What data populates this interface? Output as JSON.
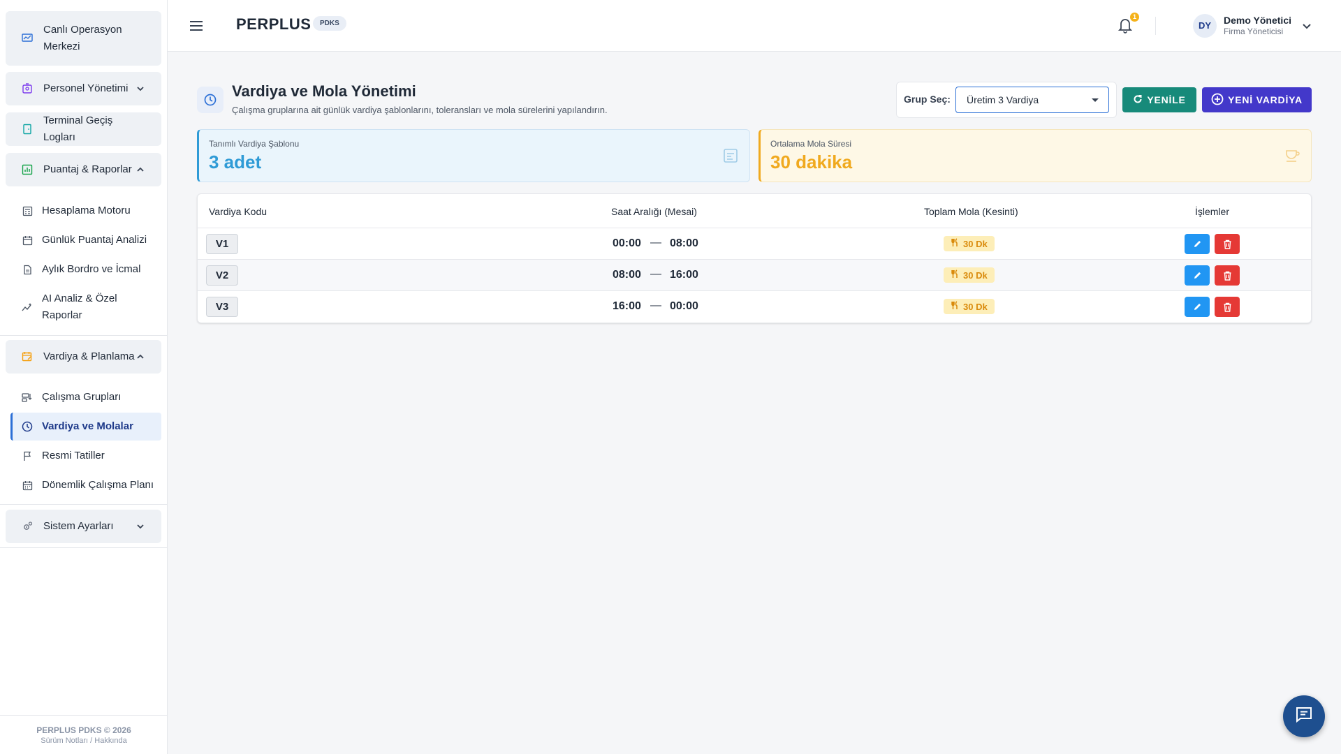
{
  "sidebar": {
    "groups": {
      "live": {
        "label": "Canlı Operasyon\nMerkezi"
      },
      "personnel": {
        "label": "Personel Yönetimi"
      },
      "terminal": {
        "label": "Terminal Geçiş Logları"
      },
      "puantaj": {
        "label": "Puantaj & Raporlar"
      },
      "vardiya": {
        "label": "Vardiya & Planlama"
      },
      "system": {
        "label": "Sistem Ayarları"
      }
    },
    "puantaj_items": [
      {
        "label": "Hesaplama Motoru"
      },
      {
        "label": "Günlük Puantaj Analizi"
      },
      {
        "label": "Aylık Bordro ve İcmal"
      },
      {
        "label": "AI Analiz & Özel\nRaporlar"
      }
    ],
    "vardiya_items": [
      {
        "label": "Çalışma Grupları"
      },
      {
        "label": "Vardiya ve Molalar"
      },
      {
        "label": "Resmi Tatiller"
      },
      {
        "label": "Dönemlik Çalışma Planı"
      }
    ],
    "footer": {
      "line1": "PERPLUS PDKS © 2026",
      "line2": "Sürüm Notları / Hakkında"
    }
  },
  "topbar": {
    "brand": "PERPLUS",
    "brand_badge": "PDKS",
    "notification_count": "1",
    "user": {
      "initials": "DY",
      "name": "Demo Yönetici",
      "role": "Firma Yöneticisi"
    }
  },
  "page": {
    "title": "Vardiya ve Mola Yönetimi",
    "subtitle": "Çalışma gruplarına ait günlük vardiya şablonlarını, toleransları ve mola sürelerini yapılandırın.",
    "group_label": "Grup Seç:",
    "group_value": "Üretim 3 Vardiya",
    "refresh_label": "YENİLE",
    "new_label": "YENİ VARDİYA"
  },
  "stats": {
    "templates": {
      "caption": "Tanımlı Vardiya Şablonu",
      "value": "3 adet"
    },
    "break": {
      "caption": "Ortalama Mola Süresi",
      "value": "30 dakika"
    }
  },
  "table": {
    "headers": {
      "code": "Vardiya Kodu",
      "range": "Saat Aralığı (Mesai)",
      "break": "Toplam Mola (Kesinti)",
      "actions": "İşlemler"
    },
    "rows": [
      {
        "code": "V1",
        "start": "00:00",
        "dash": "—",
        "end": "08:00",
        "break": "30 Dk"
      },
      {
        "code": "V2",
        "start": "08:00",
        "dash": "—",
        "end": "16:00",
        "break": "30 Dk"
      },
      {
        "code": "V3",
        "start": "16:00",
        "dash": "—",
        "end": "00:00",
        "break": "30 Dk"
      }
    ]
  },
  "colors": {
    "primary": "#2b6fd6",
    "refresh": "#178a7a",
    "new": "#4338ca",
    "stat_blue": "#2f9bd6",
    "stat_yellow": "#f0a91e",
    "edit": "#2196f3",
    "delete": "#e53935",
    "fab": "#1e4f8f"
  }
}
